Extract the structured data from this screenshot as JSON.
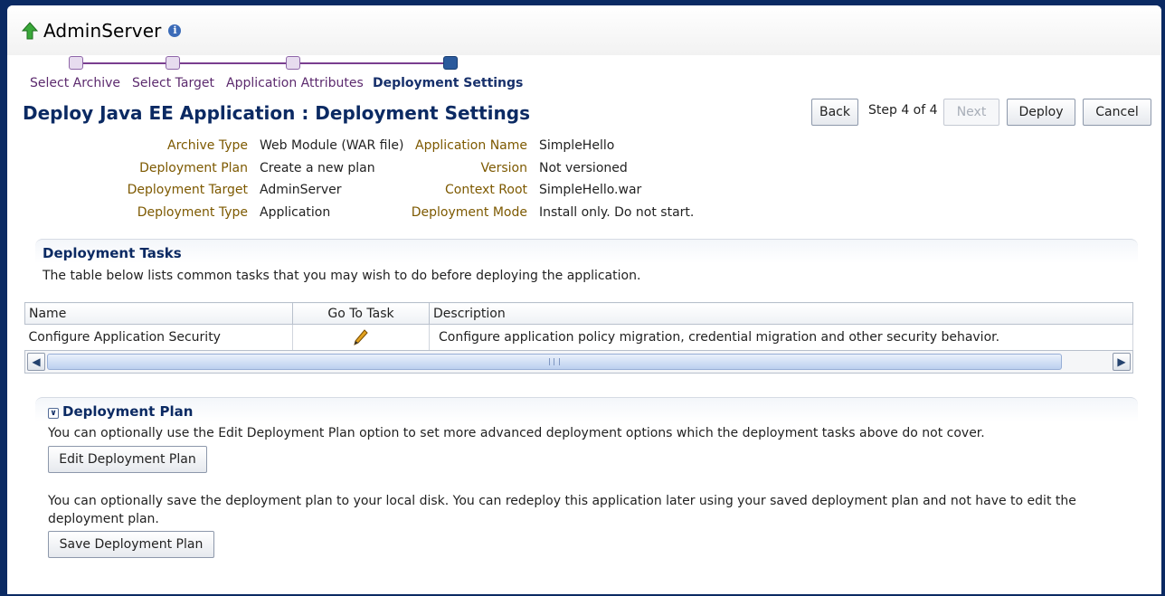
{
  "header": {
    "server_name": "AdminServer",
    "up_icon": "green-up-arrow-icon",
    "info_icon": "info-icon"
  },
  "train": {
    "steps": [
      {
        "label": "Select Archive",
        "current": false
      },
      {
        "label": "Select Target",
        "current": false
      },
      {
        "label": "Application Attributes",
        "current": false
      },
      {
        "label": "Deployment Settings",
        "current": true
      }
    ]
  },
  "page": {
    "title": "Deploy Java EE Application : Deployment Settings"
  },
  "navigation": {
    "back_label": "Back",
    "step_text": "Step 4 of 4",
    "next_label": "Next",
    "deploy_label": "Deploy",
    "cancel_label": "Cancel"
  },
  "properties": {
    "left": [
      {
        "label": "Archive Type",
        "value": "Web Module (WAR file)"
      },
      {
        "label": "Deployment Plan",
        "value": "Create a new plan"
      },
      {
        "label": "Deployment Target",
        "value": "AdminServer"
      },
      {
        "label": "Deployment Type",
        "value": "Application"
      }
    ],
    "right": [
      {
        "label": "Application Name",
        "value": "SimpleHello"
      },
      {
        "label": "Version",
        "value": "Not versioned"
      },
      {
        "label": "Context Root",
        "value": "SimpleHello.war"
      },
      {
        "label": "Deployment Mode",
        "value": "Install only. Do not start."
      }
    ]
  },
  "deployment_tasks": {
    "title": "Deployment Tasks",
    "description": "The table below lists common tasks that you may wish to do before deploying the application.",
    "columns": [
      "Name",
      "Go To Task",
      "Description"
    ],
    "rows": [
      {
        "name": "Configure Application Security",
        "go_to_task_icon": "pencil-icon",
        "description": "Configure application policy migration, credential migration and other security behavior."
      }
    ]
  },
  "deployment_plan": {
    "title": "Deployment Plan",
    "edit_text": "You can optionally use the Edit Deployment Plan option to set more advanced deployment options which the deployment tasks above do not cover.",
    "edit_button": "Edit Deployment Plan",
    "save_text": "You can optionally save the deployment plan to your local disk. You can redeploy this application later using your saved deployment plan and not have to edit the deployment plan.",
    "save_button": "Save Deployment Plan"
  },
  "colors": {
    "brand_navy": "#0b2a63",
    "train_purple": "#7a3e8f",
    "label_gold": "#7d5900"
  }
}
